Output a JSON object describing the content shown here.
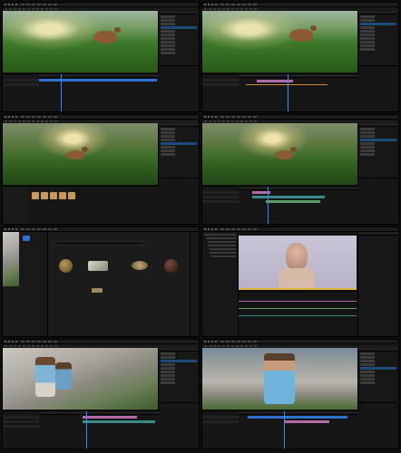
{
  "grid": {
    "panels": [
      {
        "scene": "grass-deer",
        "timeline_label": "",
        "outliner_rows": 14
      },
      {
        "scene": "grass-deer-2",
        "timeline_label": "",
        "outliner_rows": 14
      },
      {
        "scene": "forest-deer",
        "timeline_label": "",
        "outliner_rows": 12
      },
      {
        "scene": "forest-deer-2",
        "timeline_label": "",
        "outliner_rows": 12
      },
      {
        "scene": "content-browser",
        "timeline_label": "",
        "outliner_rows": 0
      },
      {
        "scene": "metahuman-face",
        "timeline_label": "",
        "outliner_rows": 0
      },
      {
        "scene": "rocky-character",
        "timeline_label": "",
        "outliner_rows": 14
      },
      {
        "scene": "rocky-character-2",
        "timeline_label": "",
        "outliner_rows": 14
      }
    ]
  },
  "colors": {
    "accent_blue": "#2f8bff",
    "selection": "#1e4a7a",
    "track_pink": "#b06aa8",
    "track_orange": "#d08a3a",
    "track_green": "#5aa06a",
    "track_teal": "#3a8a8a"
  },
  "icons": [
    "play-icon",
    "folder-icon",
    "search-icon",
    "camera-icon",
    "sphere-icon",
    "character-icon"
  ]
}
